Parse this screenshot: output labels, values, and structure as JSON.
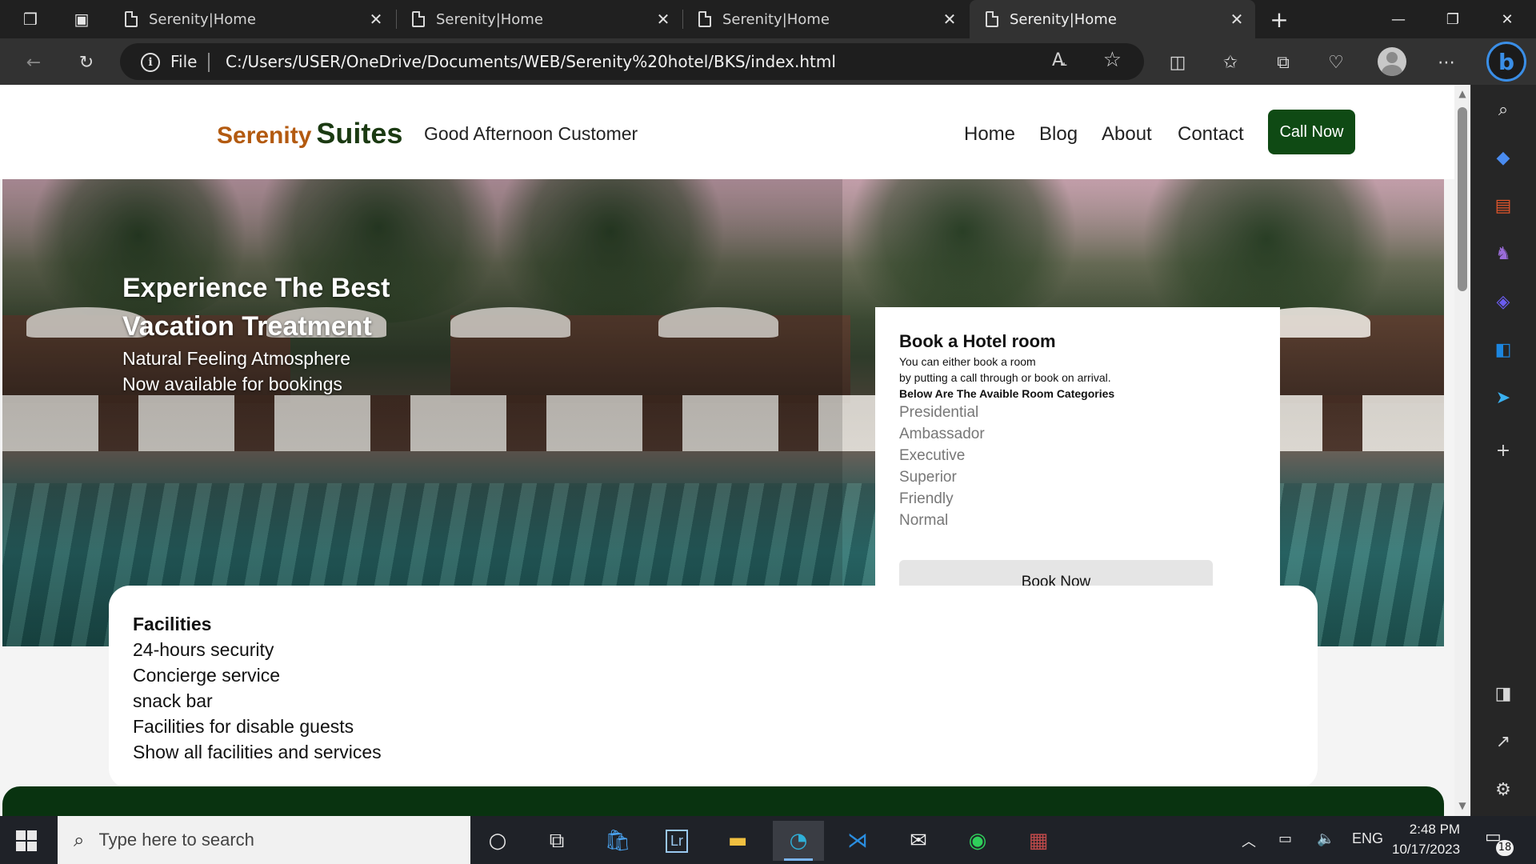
{
  "browser": {
    "tabs": [
      {
        "title": "Serenity|Home"
      },
      {
        "title": "Serenity|Home"
      },
      {
        "title": "Serenity|Home"
      },
      {
        "title": "Serenity|Home"
      }
    ],
    "active_tab_index": 3,
    "address": {
      "scheme_label": "File",
      "url": "C:/Users/USER/OneDrive/Documents/WEB/Serenity%20hotel/BKS/index.html"
    },
    "toolbar_icons": [
      "back-icon",
      "refresh-icon",
      "info-icon",
      "read-aloud-icon",
      "favorite-star-icon",
      "split-screen-icon",
      "favorites-icon",
      "collections-icon",
      "performance-icon",
      "profile-avatar",
      "more-icon",
      "bing-chat-icon"
    ],
    "side_panel_icons": [
      "search-icon",
      "shopping-tag-icon",
      "tools-briefcase-icon",
      "games-icon",
      "office-icon",
      "outlook-icon",
      "drop-send-icon",
      "add-icon",
      "sidebar-toggle-icon",
      "external-link-icon",
      "settings-icon"
    ]
  },
  "site": {
    "brand_first": "Serenity",
    "brand_second": "Suites",
    "greeting": "Good Afternoon Customer",
    "nav": [
      "Home",
      "Blog",
      "About",
      "Contact"
    ],
    "call_button": "Call Now",
    "colors": {
      "brand_orange": "#b35a10",
      "brand_green": "#1b3a12",
      "button_green": "#0f4a14",
      "footer_green": "#093310"
    },
    "hero": {
      "title": "Experience The Best Vacation Treatment",
      "line1": "Natural Feeling Atmosphere",
      "line2": "Now available for bookings"
    },
    "booking": {
      "title": "Book a Hotel room",
      "desc1": "You can either book a room",
      "desc2": "by putting a call through or book on arrival.",
      "categories_heading": "Below Are The Avaible Room Categories",
      "categories": [
        "Presidential",
        "Ambassador",
        "Executive",
        "Superior",
        "Friendly",
        "Normal"
      ],
      "button": "Book Now"
    },
    "facilities": {
      "title": "Facilities",
      "items": [
        "24-hours security",
        "Concierge service",
        "snack bar",
        "Facilities for disable guests",
        "Show all facilities and services"
      ]
    }
  },
  "taskbar": {
    "search_placeholder": "Type here to search",
    "apps": [
      "cortana-icon",
      "task-view-icon",
      "store-icon",
      "lightroom-icon",
      "file-explorer-icon",
      "edge-icon",
      "vscode-icon",
      "mail-icon",
      "whatsapp-icon",
      "game-icon"
    ],
    "lightroom_label": "Lr",
    "language": "ENG",
    "time": "2:48 PM",
    "date": "10/17/2023",
    "notification_count": "18"
  }
}
